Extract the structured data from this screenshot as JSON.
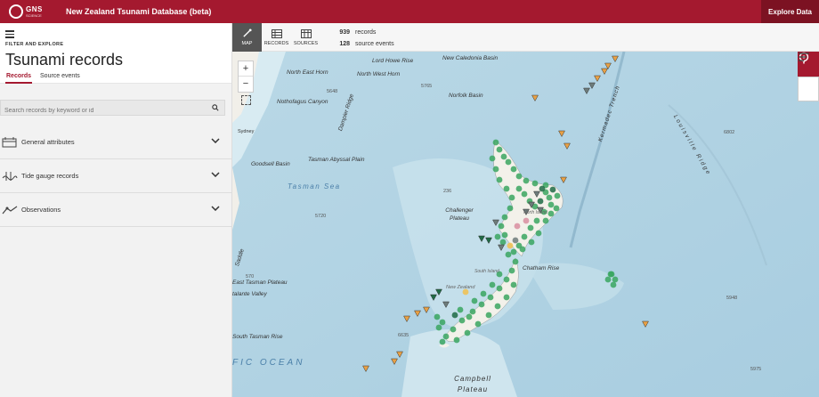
{
  "header": {
    "logo_text": "GNS",
    "logo_sub": "SCIENCE",
    "app_title": "New Zealand Tsunami Database (beta)",
    "explore_button": "Explore Data",
    "brand_color": "#a4192f"
  },
  "sidebar": {
    "filter_label": "FILTER AND EXPLORE",
    "title": "Tsunami records",
    "tabs": [
      {
        "label": "Records",
        "active": true
      },
      {
        "label": "Source events",
        "active": false
      }
    ],
    "search_placeholder": "Search records by keyword or id",
    "sections": [
      {
        "label": "General attributes",
        "icon": "calendar-icon"
      },
      {
        "label": "Tide gauge records",
        "icon": "tide-gauge-icon"
      },
      {
        "label": "Observations",
        "icon": "observation-icon"
      }
    ]
  },
  "toolbar": {
    "buttons": [
      {
        "label": "MAP",
        "icon": "map-icon",
        "active": true
      },
      {
        "label": "RECORDS",
        "icon": "table-icon",
        "active": false
      },
      {
        "label": "SOURCES",
        "icon": "sources-icon",
        "active": false
      }
    ],
    "record_count": "939",
    "record_label": "records",
    "source_count": "128",
    "source_label": "source events"
  },
  "map": {
    "zoom_in": "+",
    "zoom_out": "−",
    "labels": {
      "lord_howe_rise": "Lord Howe Rise",
      "new_caledonia_basin": "New Caledonia Basin",
      "north_east_horn": "North East Horn",
      "north_west_horn": "North West Horn",
      "norfolk_basin": "Norfolk Basin",
      "nothofagus_canyon": "Nothofagus Canyon",
      "dampier_ridge": "Dampier Ridge",
      "kermadec_trench": "Kermadec Trench",
      "louisville_ridge": "Louisville Ridge",
      "sydney": "Sydney",
      "goodsell_basin": "Goodsell Basin",
      "tasman_abyssal_plain": "Tasman Abyssal Plain",
      "tasman_sea": "Tasman Sea",
      "challenger_plateau": "Challenger Plateau",
      "chatham_rise": "Chatham Rise",
      "new_zealand": "New Zealand",
      "east_tasman_plateau": "East Tasman Plateau",
      "talante_valley": "talante Valley",
      "south_tasman_rise": "South Tasman Rise",
      "pacific_ocean": "FIC OCEAN",
      "campbell_plateau": "Campbell Plateau",
      "saddle": "Saddle",
      "north_island": "North Island",
      "south_island": "South Island"
    },
    "depths": [
      "5648",
      "5765",
      "6802",
      "236",
      "5720",
      "570",
      "6635",
      "5948",
      "5975",
      "500"
    ],
    "marker_colors": {
      "green": "#3aa660",
      "dark_green": "#1f6b45",
      "orange": "#e8a045",
      "pink": "#d88ea0",
      "yellow": "#f2c14e",
      "grey": "#6d7b7a"
    }
  }
}
